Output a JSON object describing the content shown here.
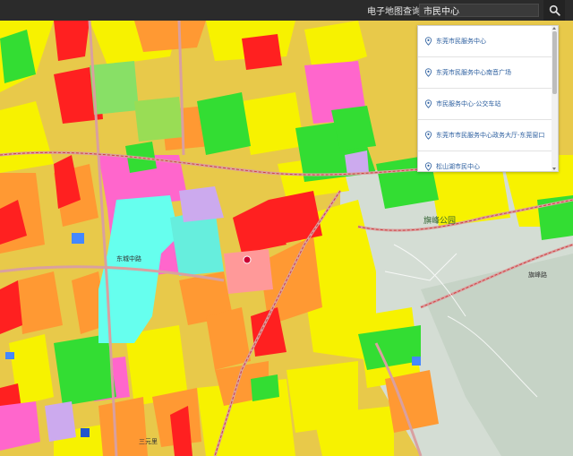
{
  "header": {
    "title": "电子地图查询 -",
    "search_value": "市民中心"
  },
  "results": [
    {
      "label": "东莞市民服务中心"
    },
    {
      "label": "东莞市民服务中心南音广场"
    },
    {
      "label": "市民服务中心-公交车站"
    },
    {
      "label": "东莞市市民服务中心政务大厅-东莞窗口"
    },
    {
      "label": "松山湖市民中心"
    }
  ],
  "map": {
    "park_label": "旗峰公园",
    "road_label_1": "旗峰路",
    "road_label_2": "东城中路",
    "road_label_3": "三元里"
  },
  "icons": {
    "search": "search-icon",
    "pin": "location-pin-icon"
  },
  "colors": {
    "topbar": "#2b2b2b",
    "result_text": "#2a5d9e",
    "residential": "#f7f200",
    "commercial": "#ff2020",
    "public": "#ff66cc",
    "green": "#33dd33",
    "education": "#ff9933",
    "water": "#66ffee"
  }
}
